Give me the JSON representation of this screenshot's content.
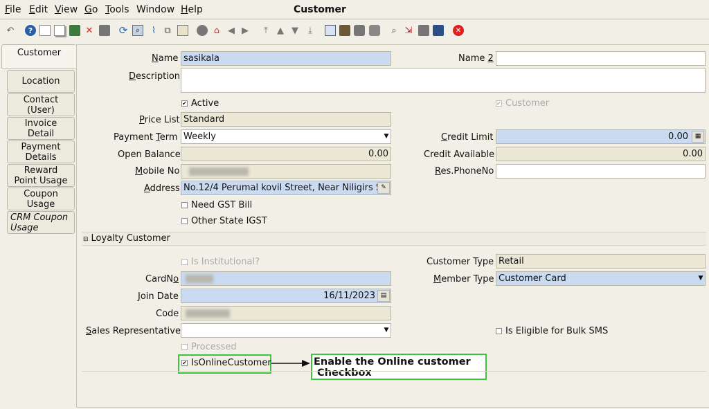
{
  "menu": [
    "File",
    "Edit",
    "View",
    "Go",
    "Tools",
    "Window",
    "Help"
  ],
  "window_title": "Customer",
  "toolbar_icons": [
    "undo-icon",
    "help-icon",
    "new-icon",
    "copy-icon",
    "save-icon",
    "delete-icon",
    "delete-selection-icon",
    "refresh-icon",
    "find-icon",
    "attachment-icon",
    "history-icon",
    "grid-toggle-icon",
    "parent-icon",
    "home-icon",
    "back-icon",
    "forward-icon",
    "first-icon",
    "previous-icon",
    "next-icon",
    "last-icon",
    "report-icon",
    "archive-icon",
    "print-icon",
    "print-preview-icon",
    "zoom-across-icon",
    "workflow-icon",
    "request-icon",
    "product-info-icon",
    "exit-icon"
  ],
  "tabs": [
    "Customer",
    "Location",
    "Contact (User)",
    "Invoice Detail",
    "Payment Details",
    "Reward Point Usage",
    "Coupon Usage",
    "CRM Coupon Usage"
  ],
  "form": {
    "name_label": "ame",
    "name_value": "sasikala",
    "name2_label": "Name ",
    "name2_suffix": "2",
    "description_label": "escription",
    "active_label": "Active",
    "customer_label": "Customer",
    "price_list_label": "rice List",
    "price_list_value": "Standard",
    "payment_term_label": "Payment ",
    "payment_term_label2": "erm",
    "payment_term_value": "Weekly",
    "credit_limit_label": "redit Limit",
    "credit_limit_value": "0.00",
    "open_balance_label": "Open Balance",
    "open_balance_value": "0.00",
    "credit_available_label": "Credit Available",
    "credit_available_value": "0.00",
    "mobile_label": "obile No",
    "res_phone_label": "es.PhoneNo",
    "address_label": "ddress",
    "address_value": "No.12/4 Perumal kovil Street, Near Niligirs S",
    "need_gst_label": "Need GST Bill",
    "other_state_label": "Other State IGST",
    "section_title": "Loyalty Customer",
    "institutional_label": "Is Institutional?",
    "customer_type_label": "Customer Type",
    "customer_type_value": "Retail",
    "cardno_label": "CardN",
    "cardno_label2": "o",
    "member_type_label": "ember Type",
    "member_type_value": "Customer Card",
    "join_date_label": "oin Date",
    "join_date_value": "16/11/2023",
    "code_label": "Code",
    "sales_rep_label": "ales Representative",
    "bulk_sms_label": "Is Eligible for Bulk SMS",
    "processed_label": "Processed",
    "online_customer_label": "IsOnlineCustomer"
  },
  "annotation": {
    "line1": "Enable the Online customer",
    "line2": " Checkbox"
  },
  "colors": {
    "highlight_green": "#3cc43c",
    "mandatory_field": "#c9daf1",
    "readonly_field": "#ebe8d6",
    "background": "#f2efe6"
  }
}
